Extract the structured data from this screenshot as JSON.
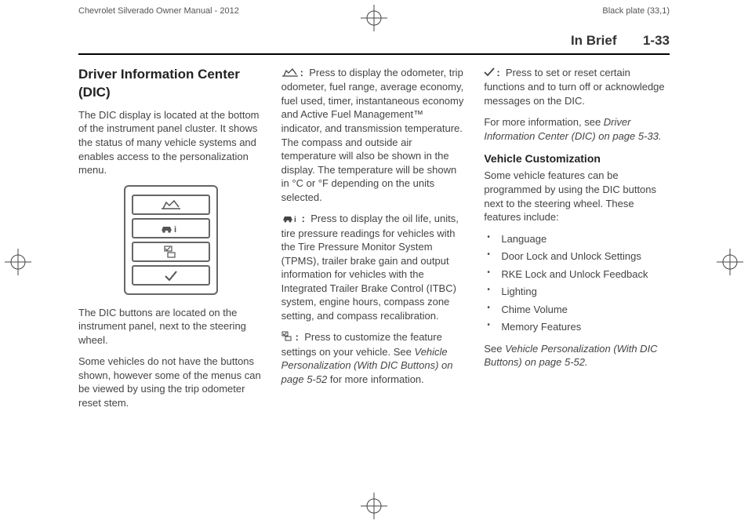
{
  "header": {
    "left": "Chevrolet Silverado Owner Manual - 2012",
    "right": "Black plate (33,1)"
  },
  "section": {
    "title": "In Brief",
    "page": "1-33"
  },
  "col1": {
    "heading": "Driver Information Center (DIC)",
    "p1": "The DIC display is located at the bottom of the instrument panel cluster. It shows the status of many vehicle systems and enables access to the personalization menu.",
    "p2": "The DIC buttons are located on the instrument panel, next to the steering wheel.",
    "p3": "Some vehicles do not have the buttons shown, however some of the menus can be viewed by using the trip odometer reset stem."
  },
  "col2": {
    "b1": "Press to display the odometer, trip odometer, fuel range, average economy, fuel used, timer, instantaneous economy and Active Fuel Management™ indicator, and transmission temperature. The compass and outside air temperature will also be shown in the display. The temperature will be shown in °C or °F depending on the units selected.",
    "b2": "Press to display the oil life, units, tire pressure readings for vehicles with the Tire Pressure Monitor System (TPMS), trailer brake gain and output information for vehicles with the Integrated Trailer Brake Control (ITBC) system, engine hours, compass zone setting, and compass recalibration.",
    "b3a": "Press to customize the feature settings on your vehicle. See ",
    "b3b": "Vehicle Personalization (With DIC Buttons) on page 5-52",
    "b3c": " for more information."
  },
  "col3": {
    "p1": "Press to set or reset certain functions and to turn off or acknowledge messages on the DIC.",
    "p2a": "For more information, see ",
    "p2b": "Driver Information Center (DIC) on page 5-33.",
    "h3": "Vehicle Customization",
    "p3": "Some vehicle features can be programmed by using the DIC buttons next to the steering wheel. These features include:",
    "features": [
      "Language",
      "Door Lock and Unlock Settings",
      "RKE Lock and Unlock Feedback",
      "Lighting",
      "Chime Volume",
      "Memory Features"
    ],
    "p4a": "See ",
    "p4b": "Vehicle Personalization (With DIC Buttons) on page 5-52."
  }
}
